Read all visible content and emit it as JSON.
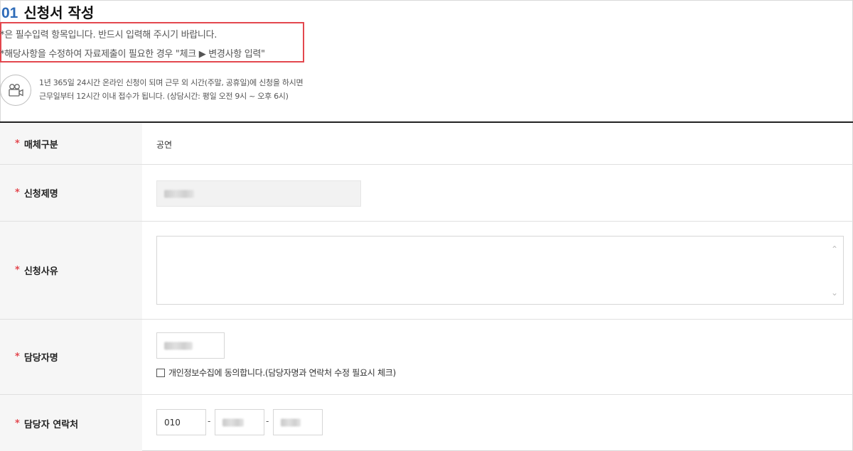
{
  "header": {
    "step_number": "01",
    "title": "신청서 작성"
  },
  "notice": {
    "line1": "*은 필수입력 항목입니다. 반드시 입력해 주시기 바랍니다.",
    "line2": "*해당사항을 수정하여 자료제출이 필요한 경우 \"체크 ▶ 변경사항 입력\"",
    "highlight_color": "#e3474e"
  },
  "info": {
    "icon": "video-camera-icon",
    "line1": "1년 365일 24시간 온라인 신청이 되며 근무 외 시간(주말, 공휴일)에 신청을 하시면",
    "line2": "근무일부터 12시간 이내 접수가 됩니다. (상담시간: 평일 오전 9시 ~ 오후 6시)"
  },
  "form": {
    "required_mark": "*",
    "media_type": {
      "label": "매체구분",
      "value": "공연"
    },
    "request_title": {
      "label": "신청제명"
    },
    "request_reason": {
      "label": "신청사유",
      "value": ""
    },
    "manager_name": {
      "label": "담당자명",
      "consent_text": "개인정보수집에 동의합니다.(담당자명과 연락처 수정 필요시 체크)",
      "consent_checked": false
    },
    "manager_phone": {
      "label": "담당자 연락처",
      "part1": "010",
      "separator": "-"
    }
  },
  "colors": {
    "accent_blue": "#2e6bb8",
    "required_red": "#e3474e"
  }
}
